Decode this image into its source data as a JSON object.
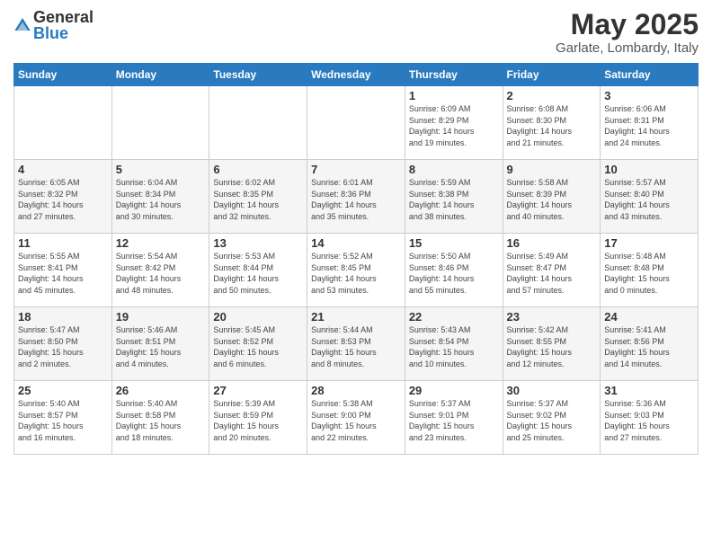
{
  "logo": {
    "general": "General",
    "blue": "Blue"
  },
  "title": "May 2025",
  "location": "Garlate, Lombardy, Italy",
  "days_of_week": [
    "Sunday",
    "Monday",
    "Tuesday",
    "Wednesday",
    "Thursday",
    "Friday",
    "Saturday"
  ],
  "weeks": [
    [
      {
        "day": "",
        "info": ""
      },
      {
        "day": "",
        "info": ""
      },
      {
        "day": "",
        "info": ""
      },
      {
        "day": "",
        "info": ""
      },
      {
        "day": "1",
        "info": "Sunrise: 6:09 AM\nSunset: 8:29 PM\nDaylight: 14 hours\nand 19 minutes."
      },
      {
        "day": "2",
        "info": "Sunrise: 6:08 AM\nSunset: 8:30 PM\nDaylight: 14 hours\nand 21 minutes."
      },
      {
        "day": "3",
        "info": "Sunrise: 6:06 AM\nSunset: 8:31 PM\nDaylight: 14 hours\nand 24 minutes."
      }
    ],
    [
      {
        "day": "4",
        "info": "Sunrise: 6:05 AM\nSunset: 8:32 PM\nDaylight: 14 hours\nand 27 minutes."
      },
      {
        "day": "5",
        "info": "Sunrise: 6:04 AM\nSunset: 8:34 PM\nDaylight: 14 hours\nand 30 minutes."
      },
      {
        "day": "6",
        "info": "Sunrise: 6:02 AM\nSunset: 8:35 PM\nDaylight: 14 hours\nand 32 minutes."
      },
      {
        "day": "7",
        "info": "Sunrise: 6:01 AM\nSunset: 8:36 PM\nDaylight: 14 hours\nand 35 minutes."
      },
      {
        "day": "8",
        "info": "Sunrise: 5:59 AM\nSunset: 8:38 PM\nDaylight: 14 hours\nand 38 minutes."
      },
      {
        "day": "9",
        "info": "Sunrise: 5:58 AM\nSunset: 8:39 PM\nDaylight: 14 hours\nand 40 minutes."
      },
      {
        "day": "10",
        "info": "Sunrise: 5:57 AM\nSunset: 8:40 PM\nDaylight: 14 hours\nand 43 minutes."
      }
    ],
    [
      {
        "day": "11",
        "info": "Sunrise: 5:55 AM\nSunset: 8:41 PM\nDaylight: 14 hours\nand 45 minutes."
      },
      {
        "day": "12",
        "info": "Sunrise: 5:54 AM\nSunset: 8:42 PM\nDaylight: 14 hours\nand 48 minutes."
      },
      {
        "day": "13",
        "info": "Sunrise: 5:53 AM\nSunset: 8:44 PM\nDaylight: 14 hours\nand 50 minutes."
      },
      {
        "day": "14",
        "info": "Sunrise: 5:52 AM\nSunset: 8:45 PM\nDaylight: 14 hours\nand 53 minutes."
      },
      {
        "day": "15",
        "info": "Sunrise: 5:50 AM\nSunset: 8:46 PM\nDaylight: 14 hours\nand 55 minutes."
      },
      {
        "day": "16",
        "info": "Sunrise: 5:49 AM\nSunset: 8:47 PM\nDaylight: 14 hours\nand 57 minutes."
      },
      {
        "day": "17",
        "info": "Sunrise: 5:48 AM\nSunset: 8:48 PM\nDaylight: 15 hours\nand 0 minutes."
      }
    ],
    [
      {
        "day": "18",
        "info": "Sunrise: 5:47 AM\nSunset: 8:50 PM\nDaylight: 15 hours\nand 2 minutes."
      },
      {
        "day": "19",
        "info": "Sunrise: 5:46 AM\nSunset: 8:51 PM\nDaylight: 15 hours\nand 4 minutes."
      },
      {
        "day": "20",
        "info": "Sunrise: 5:45 AM\nSunset: 8:52 PM\nDaylight: 15 hours\nand 6 minutes."
      },
      {
        "day": "21",
        "info": "Sunrise: 5:44 AM\nSunset: 8:53 PM\nDaylight: 15 hours\nand 8 minutes."
      },
      {
        "day": "22",
        "info": "Sunrise: 5:43 AM\nSunset: 8:54 PM\nDaylight: 15 hours\nand 10 minutes."
      },
      {
        "day": "23",
        "info": "Sunrise: 5:42 AM\nSunset: 8:55 PM\nDaylight: 15 hours\nand 12 minutes."
      },
      {
        "day": "24",
        "info": "Sunrise: 5:41 AM\nSunset: 8:56 PM\nDaylight: 15 hours\nand 14 minutes."
      }
    ],
    [
      {
        "day": "25",
        "info": "Sunrise: 5:40 AM\nSunset: 8:57 PM\nDaylight: 15 hours\nand 16 minutes."
      },
      {
        "day": "26",
        "info": "Sunrise: 5:40 AM\nSunset: 8:58 PM\nDaylight: 15 hours\nand 18 minutes."
      },
      {
        "day": "27",
        "info": "Sunrise: 5:39 AM\nSunset: 8:59 PM\nDaylight: 15 hours\nand 20 minutes."
      },
      {
        "day": "28",
        "info": "Sunrise: 5:38 AM\nSunset: 9:00 PM\nDaylight: 15 hours\nand 22 minutes."
      },
      {
        "day": "29",
        "info": "Sunrise: 5:37 AM\nSunset: 9:01 PM\nDaylight: 15 hours\nand 23 minutes."
      },
      {
        "day": "30",
        "info": "Sunrise: 5:37 AM\nSunset: 9:02 PM\nDaylight: 15 hours\nand 25 minutes."
      },
      {
        "day": "31",
        "info": "Sunrise: 5:36 AM\nSunset: 9:03 PM\nDaylight: 15 hours\nand 27 minutes."
      }
    ]
  ]
}
